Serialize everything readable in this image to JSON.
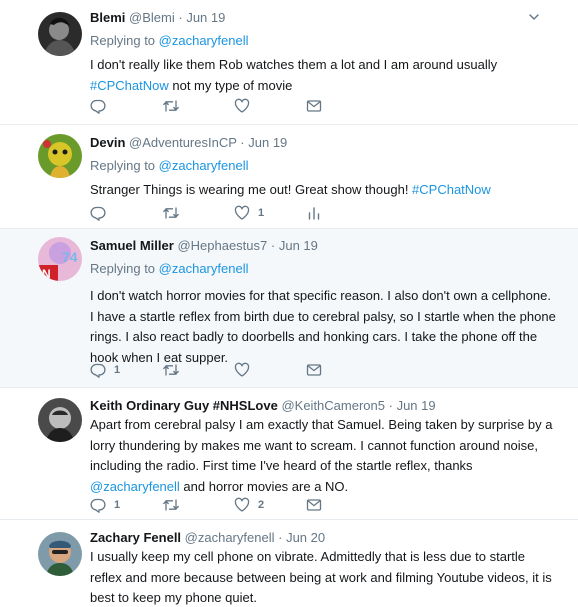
{
  "colors": {
    "link": "#1b95e0",
    "muted": "#657786",
    "highlight_bg": "#f5f8fa"
  },
  "tweets": [
    {
      "name": "Blemi",
      "handle": "@Blemi",
      "time": "Jun 19",
      "replying_label": "Replying to",
      "replying_to": "@zacharyfenell",
      "text_1": "I don't really like them  Rob watches them a lot and  I am around usually",
      "hashtag": "#CPChatNow",
      "text_2": " not my type of movie",
      "reply_count": "",
      "like_count": ""
    },
    {
      "name": "Devin",
      "handle": "@AdventuresInCP",
      "time": "Jun 19",
      "replying_label": "Replying to",
      "replying_to": "@zacharyfenell",
      "text_1": "Stranger Things is wearing me out! Great show though! ",
      "hashtag": "#CPChatNow",
      "reply_count": "",
      "like_count": "1"
    },
    {
      "name": "Samuel Miller",
      "handle": "@Hephaestus7",
      "time": "Jun 19",
      "replying_label": "Replying to",
      "replying_to": "@zacharyfenell",
      "text": "I don't watch horror movies for that specific reason. I also don't own a cellphone. I have a startle reflex from birth due to cerebral palsy, so I startle when the phone rings. I also react badly to doorbells and honking cars. I take the phone off the hook when I eat supper.",
      "reply_count": "1",
      "like_count": ""
    },
    {
      "name": "Keith Ordinary Guy #NHSLove",
      "handle": "@KeithCameron5",
      "time": "Jun 19",
      "text_1": "Apart from cerebral palsy I am exactly that Samuel. Being taken by surprise by a lorry thundering by makes me want to scream. I cannot function around noise, including the radio. First time I've heard of the startle reflex, thanks ",
      "mention": "@zacharyfenell",
      "text_2": " and horror movies are a NO.",
      "reply_count": "1",
      "like_count": "2"
    },
    {
      "name": "Zachary Fenell",
      "handle": "@zacharyfenell",
      "time": "Jun 20",
      "text": "I usually keep my cell phone on vibrate. Admittedly that is less due to startle reflex and more because between being at work and filming Youtube videos, it is best to keep my phone quiet."
    }
  ]
}
